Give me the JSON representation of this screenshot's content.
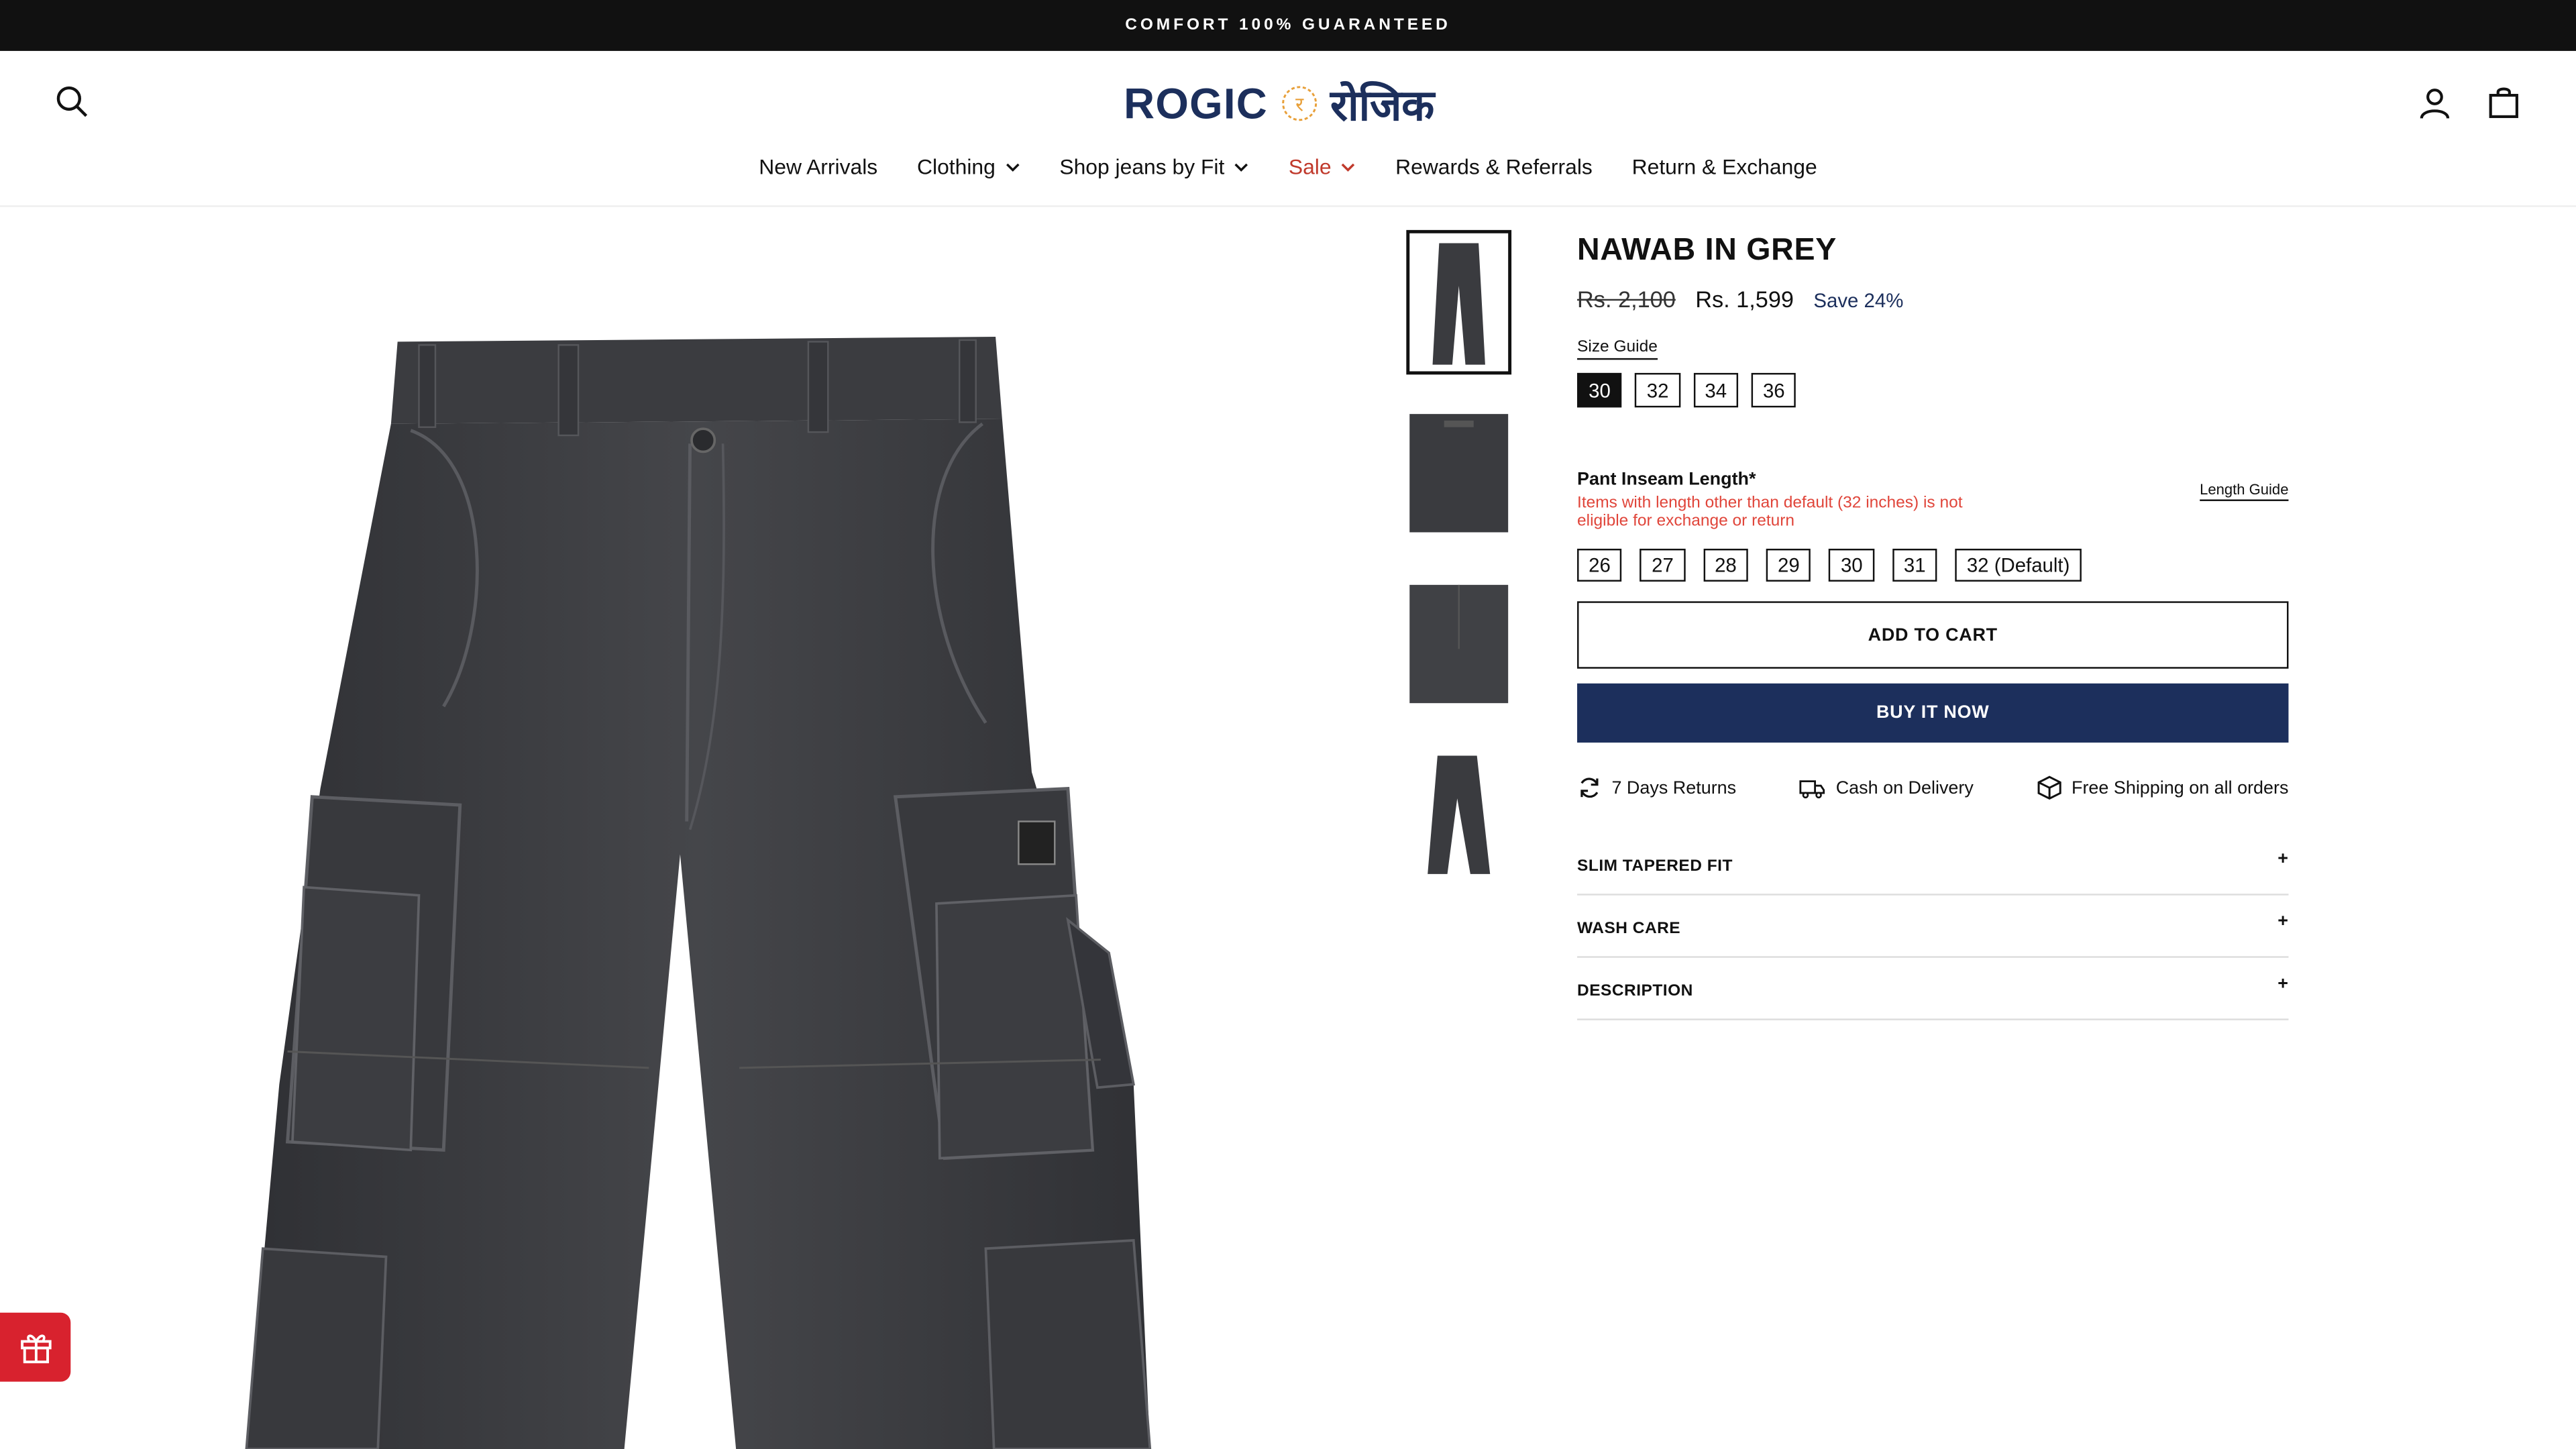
{
  "announcement": "COMFORT 100% GUARANTEED",
  "logo": {
    "latin": "ROGIC",
    "devanagari": "रोजिक",
    "badge": "र"
  },
  "nav": [
    {
      "label": "New Arrivals",
      "dropdown": false
    },
    {
      "label": "Clothing",
      "dropdown": true
    },
    {
      "label": "Shop jeans by Fit",
      "dropdown": true
    },
    {
      "label": "Sale",
      "dropdown": true
    },
    {
      "label": "Rewards & Referrals",
      "dropdown": false
    },
    {
      "label": "Return & Exchange",
      "dropdown": false
    }
  ],
  "product": {
    "title": "NAWAB IN GREY",
    "old_price": "Rs. 2,100",
    "price": "Rs. 1,599",
    "save": "Save 24%",
    "size_guide": "Size Guide",
    "sizes": [
      "30",
      "32",
      "34",
      "36"
    ],
    "selected_size": "30",
    "inseam_label": "Pant Inseam Length*",
    "inseam_note": "Items with length other than default (32 inches) is not eligible for exchange or return",
    "length_guide": "Length Guide",
    "inseams": [
      "26",
      "27",
      "28",
      "29",
      "30",
      "31",
      "32 (Default)"
    ],
    "add_to_cart": "ADD TO CART",
    "buy_now": "BUY IT NOW",
    "perks": [
      "7 Days Returns",
      "Cash on Delivery",
      "Free Shipping on all orders"
    ],
    "accordion": [
      "SLIM TAPERED FIT",
      "WASH CARE",
      "DESCRIPTION"
    ]
  },
  "colors": {
    "brand_navy": "#1c2f5c",
    "sale_red": "#c0392b",
    "denim": "#3a3b3f",
    "gift_red": "#d8222e"
  }
}
